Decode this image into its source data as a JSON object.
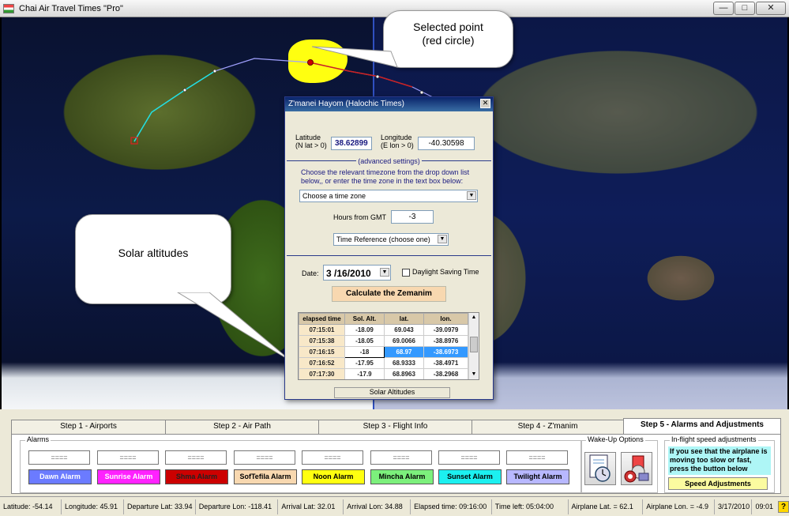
{
  "window": {
    "title": "Chai Air Travel Times \"Pro\"",
    "btn_min": "—",
    "btn_max": "□",
    "btn_close": "✕"
  },
  "callouts": {
    "selected_point": "Selected point\n(red circle)",
    "selected_point_line1": "Selected point",
    "selected_point_line2": "(red circle)",
    "solar_altitudes": "Solar altitudes"
  },
  "dialog": {
    "title": "Z'manei Hayom (Halochic Times)",
    "close": "✕",
    "latitude_label1": "Latitude",
    "latitude_label2": "(N lat > 0)",
    "latitude_value": "38.62899",
    "longitude_label1": "Longitude",
    "longitude_label2": "(E lon > 0)",
    "longitude_value": "-40.30598",
    "advanced": "(advanced settings)",
    "instruction": "Choose the relevant timezone from the drop down list below,, or enter the time zone in the text box below:",
    "timezone_combo": "Choose a time zone",
    "hours_label": "Hours from GMT",
    "hours_value": "-3",
    "time_reference": "Time Reference (choose one)",
    "date_label": "Date:",
    "date_value": "3 /16/2010",
    "dst_label": "Daylight Saving Time",
    "calc_button": "Calculate the Zemanim",
    "solar_button": "Solar Altitudes"
  },
  "grid": {
    "headers": [
      "elapsed time",
      "Sol. Alt.",
      "lat.",
      "lon."
    ],
    "rows": [
      [
        "07:15:01",
        "-18.09",
        "69.043",
        "-39.0979"
      ],
      [
        "07:15:38",
        "-18.05",
        "69.0066",
        "-38.8976"
      ],
      [
        "07:16:15",
        "-18",
        "68.97",
        "-38.6973"
      ],
      [
        "07:16:52",
        "-17.95",
        "68.9333",
        "-38.4971"
      ],
      [
        "07:17:30",
        "-17.9",
        "68.8963",
        "-38.2968"
      ]
    ]
  },
  "tabs": [
    "Step 1 - Airports",
    "Step 2 - Air Path",
    "Step 3 - Flight Info",
    "Step 4 - Z'manim",
    "Step 5 - Alarms and Adjustments"
  ],
  "alarms": {
    "label": "Alarms",
    "display": "====",
    "buttons": [
      {
        "label": "Dawn Alarm",
        "color": "#6b7bff"
      },
      {
        "label": "Sunrise Alarm",
        "color": "#ff22ff"
      },
      {
        "label": "Shma Alarm",
        "color": "#cc0000"
      },
      {
        "label": "SofTefila Alarm",
        "color": "#f8d8b0"
      },
      {
        "label": "Noon Alarm",
        "color": "#ffff10"
      },
      {
        "label": "Mincha Alarm",
        "color": "#7cf07c"
      },
      {
        "label": "Sunset Alarm",
        "color": "#1cf0f0"
      },
      {
        "label": "Twilight Alarm",
        "color": "#b8b8ff"
      }
    ]
  },
  "wakeup": {
    "label": "Wake-Up Options"
  },
  "speed": {
    "label": "In-flight speed adjustments",
    "text": "If you see that the airplane is moving too slow or fast, press the button below",
    "button": "Speed Adjustments"
  },
  "statusbar": [
    "Latitude: -54.14",
    "Longitude: 45.91",
    "Departure Lat: 33.94",
    "Departure Lon: -118.41",
    "Arrival Lat: 32.01",
    "Arrival Lon: 34.88",
    "Elapsed time: 09:16:00",
    "Time left: 05:04:00",
    "Airplane Lat. = 62.1",
    "Airplane Lon. = -4.9",
    "3/17/2010",
    "09:01"
  ],
  "help": "?"
}
